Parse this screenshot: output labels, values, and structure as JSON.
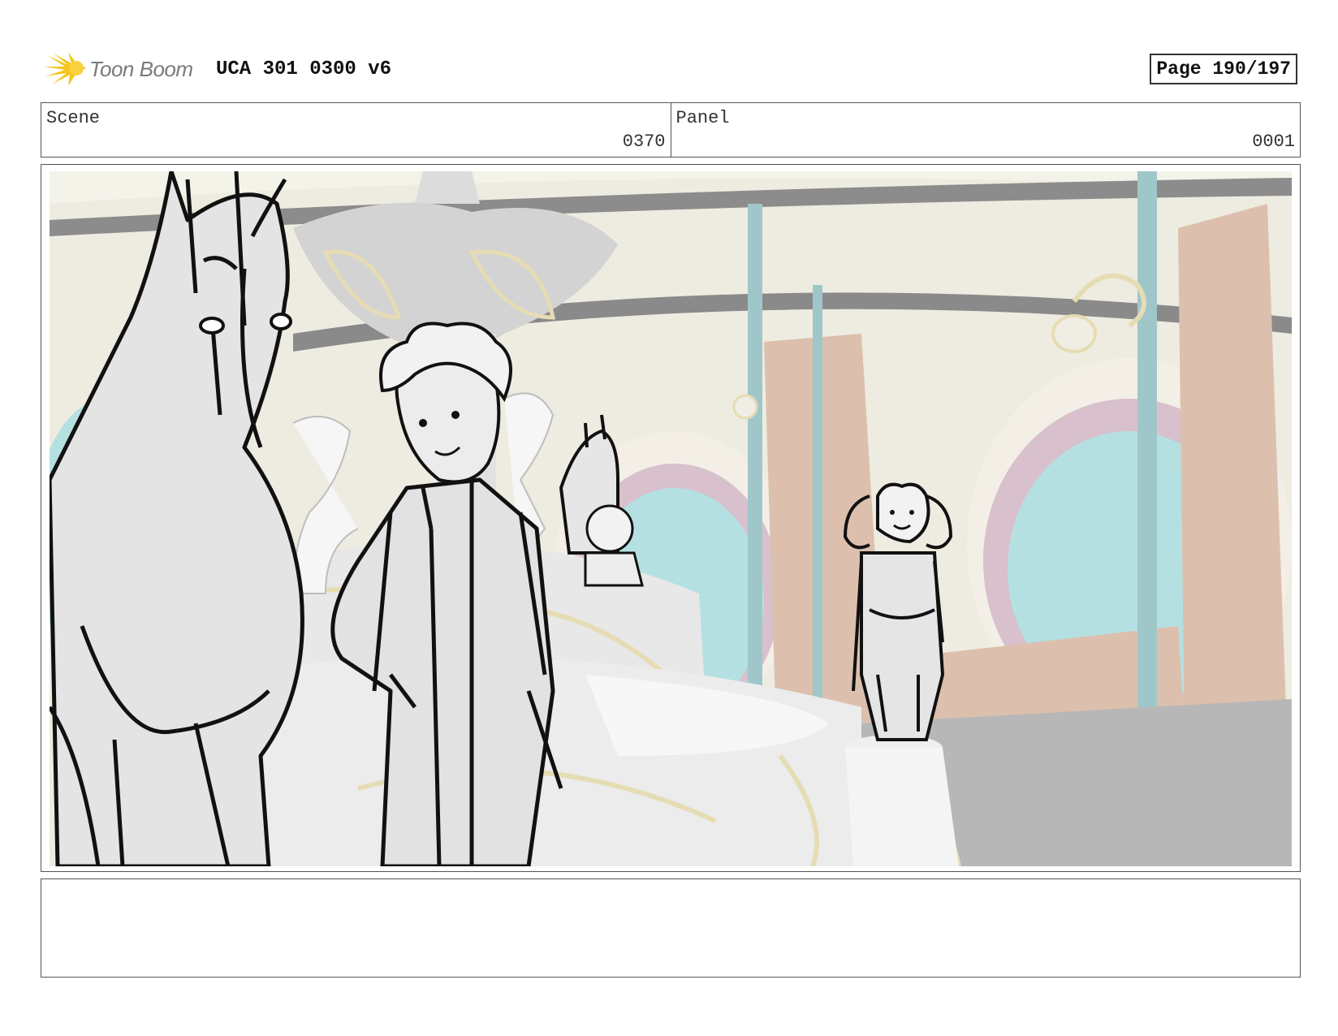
{
  "header": {
    "logo_text": "Toon Boom",
    "title": "UCA 301 0300 v6",
    "page_label": "Page 190/197"
  },
  "info": {
    "scene_label": "Scene",
    "scene_value": "0370",
    "panel_label": "Panel",
    "panel_value": "0001"
  },
  "colors": {
    "logo_yellow": "#f5c518",
    "wall_cream": "#eeece0",
    "window_teal": "#b5e0e2",
    "pillar_teal": "#9fc7c9",
    "door_peach": "#dcc0ad",
    "floor_grey": "#b7b7b7",
    "trim_gold": "#e6dcb4"
  }
}
